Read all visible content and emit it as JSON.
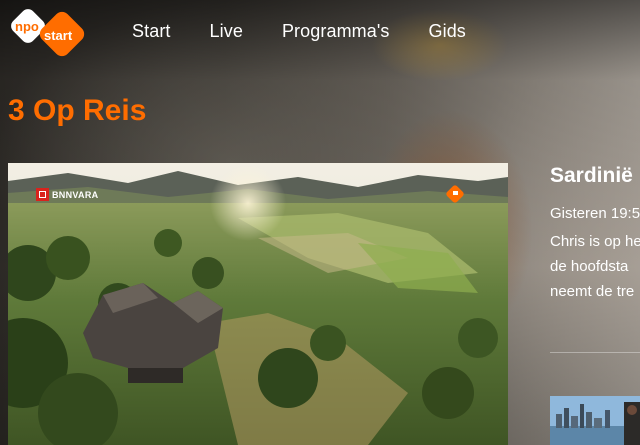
{
  "header": {
    "logo": {
      "brand_top": "npo",
      "brand_bottom": "start",
      "colors": {
        "orange": "#ff6d00",
        "white": "#ffffff",
        "grey": "#9a9a9a"
      }
    },
    "nav": [
      {
        "label": "Start"
      },
      {
        "label": "Live"
      },
      {
        "label": "Programma's"
      },
      {
        "label": "Gids"
      }
    ]
  },
  "page": {
    "title": "3 Op Reis",
    "title_color": "#ff6d00"
  },
  "player": {
    "broadcaster_label": "BNNVARA",
    "broadcaster_color": "#d9231d",
    "corner_logo_icon": "npo-icon"
  },
  "episode": {
    "title": "Sardinië",
    "meta": "Gisteren 19:5",
    "description_lines": [
      "Chris is op he",
      "de hoofdsta",
      "neemt de tre"
    ]
  },
  "next_item": {
    "thumbnail_icon": "city-skyline-thumbnail"
  }
}
